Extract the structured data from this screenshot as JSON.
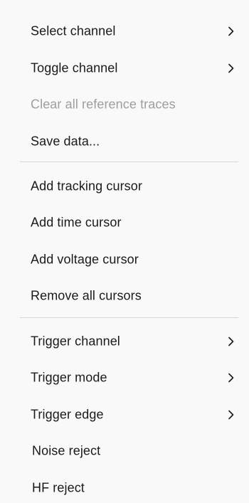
{
  "menu": {
    "items": [
      {
        "label": "Select channel",
        "submenu": true,
        "disabled": false
      },
      {
        "label": "Toggle channel",
        "submenu": true,
        "disabled": false
      },
      {
        "label": "Clear all reference traces",
        "submenu": false,
        "disabled": true
      },
      {
        "label": "Save data...",
        "submenu": false,
        "disabled": false
      },
      {
        "label": "Add tracking cursor",
        "submenu": false,
        "disabled": false
      },
      {
        "label": "Add time cursor",
        "submenu": false,
        "disabled": false
      },
      {
        "label": "Add voltage cursor",
        "submenu": false,
        "disabled": false
      },
      {
        "label": "Remove all cursors",
        "submenu": false,
        "disabled": false
      },
      {
        "label": "Trigger channel",
        "submenu": true,
        "disabled": false
      },
      {
        "label": "Trigger mode",
        "submenu": true,
        "disabled": false
      },
      {
        "label": "Trigger edge",
        "submenu": true,
        "disabled": false
      },
      {
        "label": "Noise reject",
        "submenu": false,
        "disabled": false
      },
      {
        "label": "HF reject",
        "submenu": false,
        "disabled": false
      }
    ],
    "submenu_icon": "chevron-right-icon",
    "colors": {
      "background": "#f9f9f9",
      "text": "#1a1a1a",
      "disabled_text": "#9e9e9e",
      "separator": "#d6d6d6"
    }
  }
}
